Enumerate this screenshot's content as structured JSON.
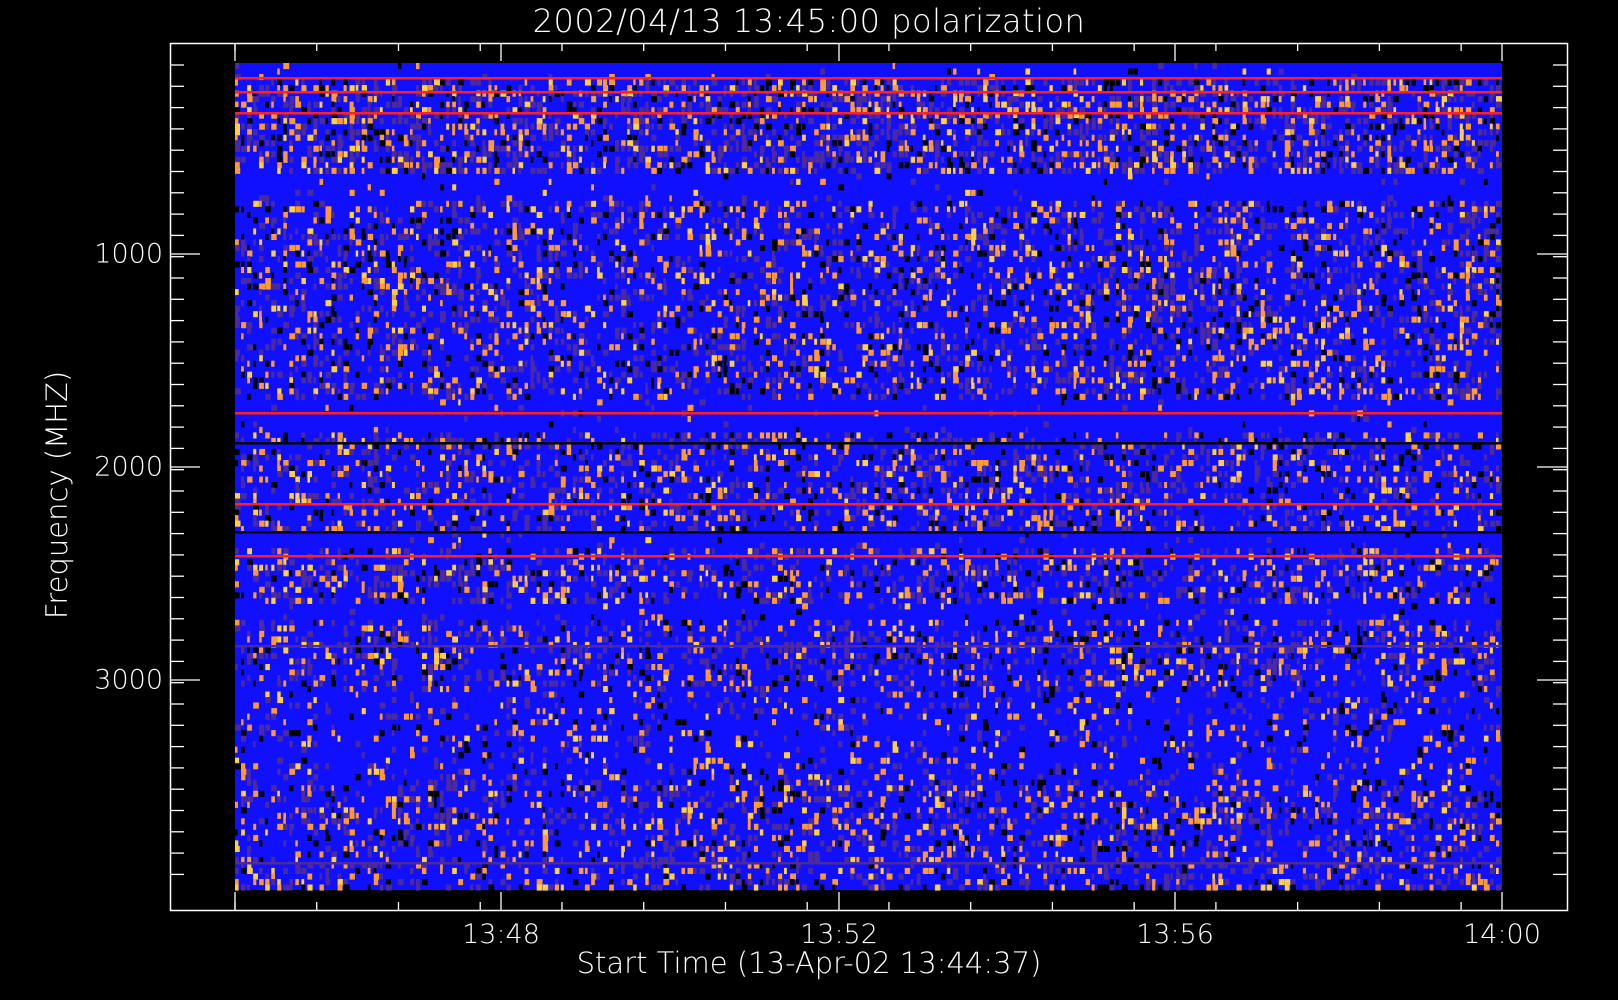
{
  "chart_data": {
    "type": "heatmap",
    "title": "2002/04/13 13:45:00 polarization",
    "xlabel": "Start Time (13-Apr-02 13:44:37)",
    "ylabel": "Frequency (MHZ)",
    "x_ticks": [
      "13:48",
      "13:52",
      "13:56",
      "14:00"
    ],
    "y_ticks": [
      "1000",
      "2000",
      "3000"
    ],
    "x_range_minutes": [
      13.75,
      14.0
    ],
    "y_range_mhz": [
      100,
      4000
    ],
    "colors": {
      "background": "#000000",
      "low": "#1010ff",
      "mid": "#4b2a9e",
      "high": "#ff9a30",
      "peak": "#ffd040",
      "line": "#ff2020"
    }
  }
}
